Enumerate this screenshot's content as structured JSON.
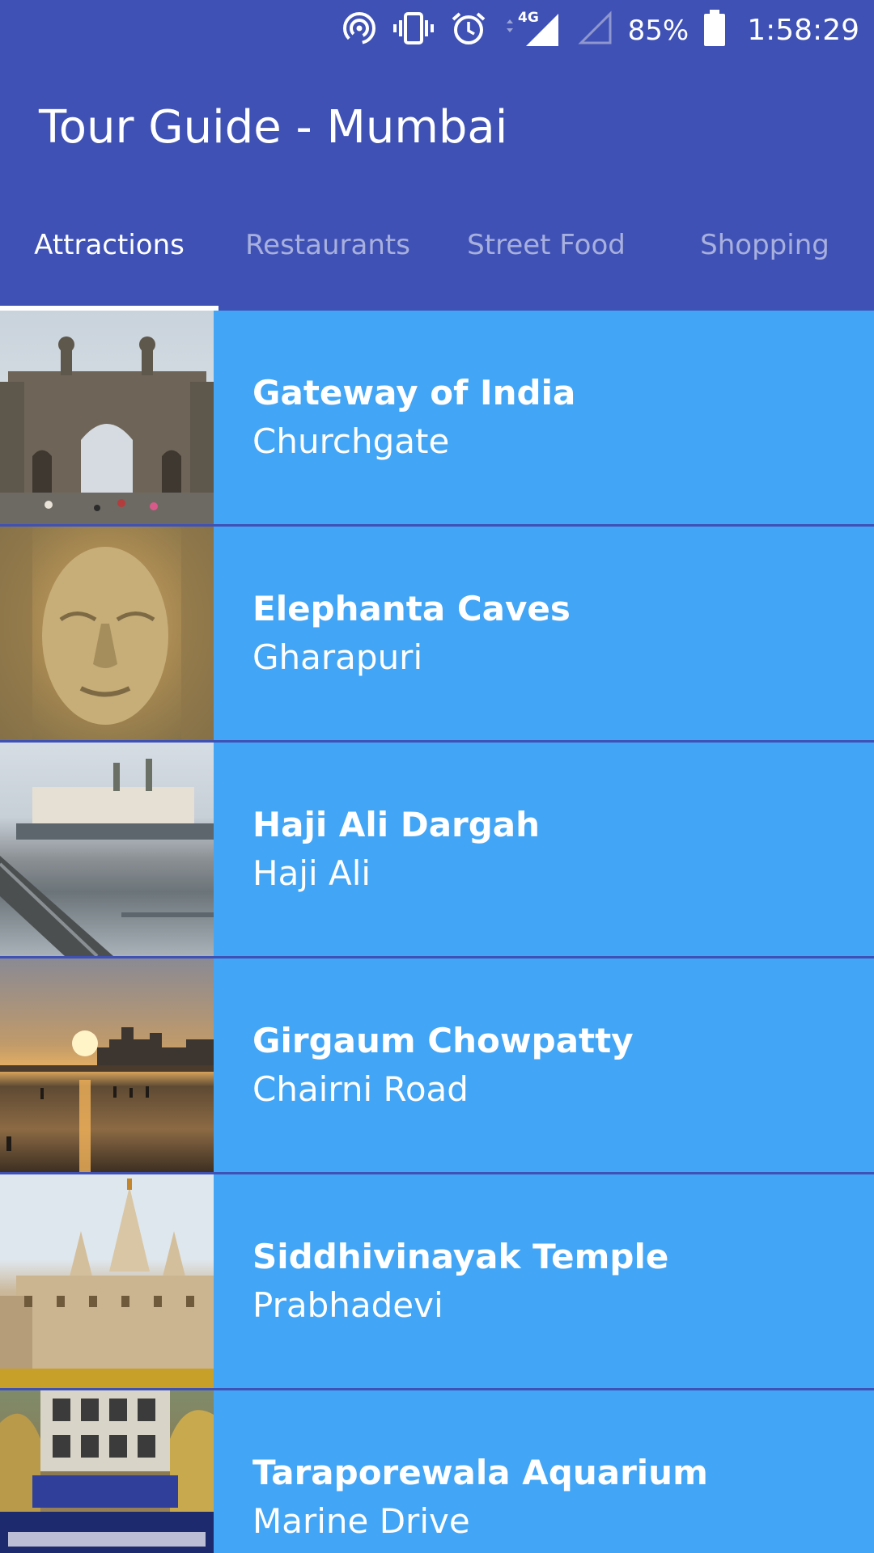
{
  "status_bar": {
    "battery": "85%",
    "time": "1:58:29",
    "network": "4G",
    "icons": [
      "hotspot-icon",
      "vibrate-icon",
      "alarm-icon",
      "signal-4g-icon",
      "signal-empty-icon",
      "battery-icon"
    ]
  },
  "app_bar": {
    "title": "Tour Guide - Mumbai"
  },
  "tabs": [
    {
      "label": "Attractions",
      "active": true
    },
    {
      "label": "Restaurants",
      "active": false
    },
    {
      "label": "Street Food",
      "active": false
    },
    {
      "label": "Shopping",
      "active": false
    }
  ],
  "items": [
    {
      "title": "Gateway of India",
      "subtitle": "Churchgate"
    },
    {
      "title": "Elephanta Caves",
      "subtitle": "Gharapuri"
    },
    {
      "title": "Haji Ali Dargah",
      "subtitle": "Haji Ali"
    },
    {
      "title": "Girgaum Chowpatty",
      "subtitle": "Chairni Road"
    },
    {
      "title": "Siddhivinayak Temple",
      "subtitle": "Prabhadevi"
    },
    {
      "title": "Taraporewala Aquarium",
      "subtitle": "Marine Drive"
    }
  ],
  "colors": {
    "primary": "#3f51b5",
    "row_background": "#42a5f5",
    "text": "#ffffff"
  }
}
